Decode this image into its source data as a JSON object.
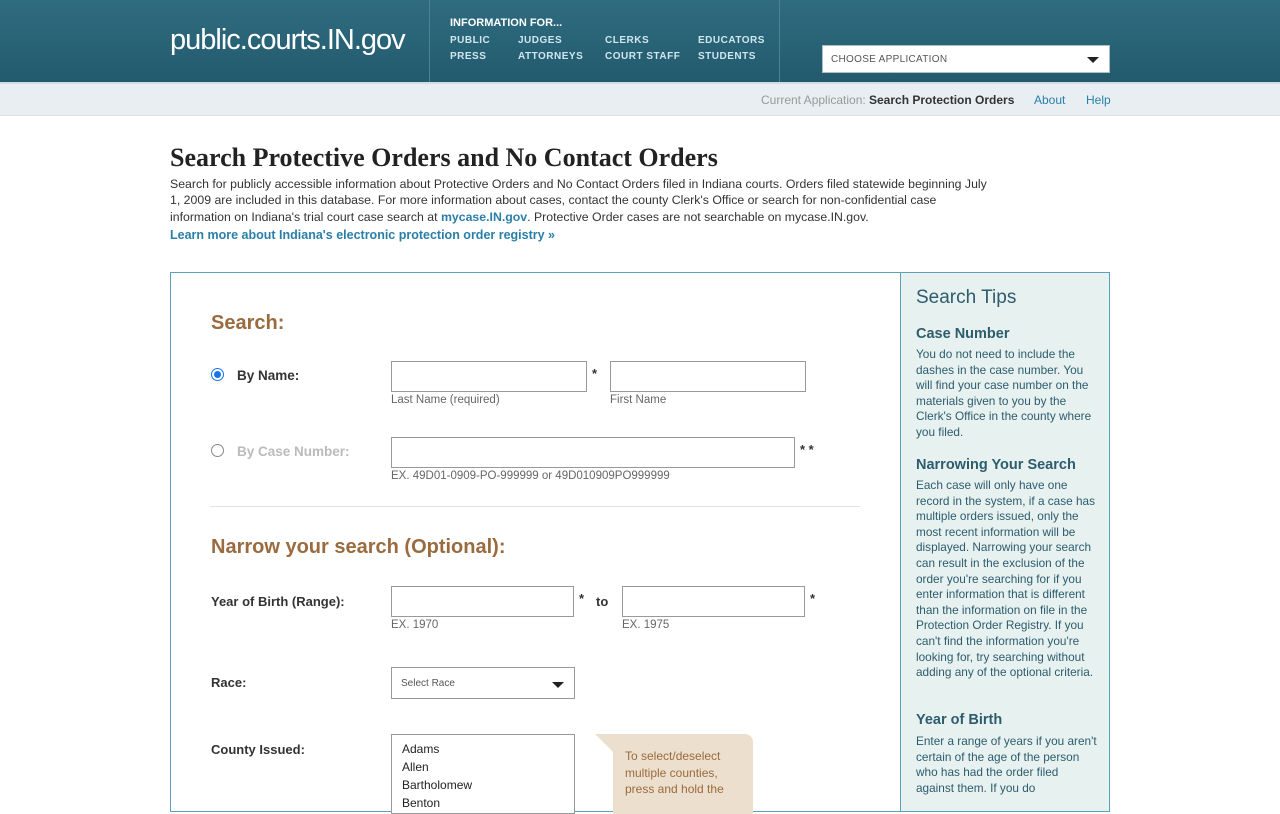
{
  "header": {
    "logo": "public.courts.IN.gov",
    "info_title": "INFORMATION FOR...",
    "links": [
      "PUBLIC",
      "JUDGES",
      "CLERKS",
      "EDUCATORS",
      "PRESS",
      "ATTORNEYS",
      "COURT STAFF",
      "STUDENTS"
    ],
    "app_select": "CHOOSE APPLICATION"
  },
  "subbar": {
    "current_label": "Current Application:",
    "current_value": "Search Protection Orders",
    "about": "About",
    "help": "Help"
  },
  "intro": {
    "title": "Search Protective Orders and No Contact Orders",
    "text_before": "Search for publicly accessible information about Protective Orders and No Contact Orders filed in Indiana courts. Orders filed statewide beginning July 1, 2009 are included in this database. For more information about cases, contact the county Clerk's Office or search for non-confidential case information on Indiana's trial court case search at ",
    "mycase_link": "mycase.IN.gov",
    "text_after": ". Protective Order cases are not searchable on mycase.IN.gov.",
    "learn_more": "Learn more about Indiana's electronic protection order registry »"
  },
  "form": {
    "search_heading": "Search:",
    "by_name_label": "By Name:",
    "last_name_hint": "Last Name (required)",
    "first_name_hint": "First Name",
    "star_single": "*",
    "star_double": "* *",
    "by_case_label": "By Case Number:",
    "case_hint": "EX. 49D01-0909-PO-999999 or 49D010909PO999999",
    "narrow_heading": "Narrow your search (Optional):",
    "yob_label": "Year of Birth (Range):",
    "yob_to": "to",
    "yob_from_hint": "EX. 1970",
    "yob_to_hint": "EX. 1975",
    "race_label": "Race:",
    "race_select": "Select Race",
    "county_label": "County Issued:",
    "counties": [
      "Adams",
      "Allen",
      "Bartholomew",
      "Benton"
    ],
    "callout": "To select/deselect multiple counties, press and hold the"
  },
  "tips": {
    "title": "Search Tips",
    "case_number_head": "Case Number",
    "case_number_body": "You do not need to include the dashes in the case number. You will find your case number on the materials given to you by the Clerk's Office in the county where you filed.",
    "narrow_head": "Narrowing Your Search",
    "narrow_body": "Each case will only have one record in the system, if a case has multiple orders issued, only the most recent information will be displayed. Narrowing your search can result in the exclusion of the order you're searching for if you enter information that is different than the information on file in the Protection Order Registry. If you can't find the information you're looking for, try searching without adding any of the optional criteria.",
    "yob_head": "Year of Birth",
    "yob_body": "Enter a range of years if you aren't certain of the age of the person who has had the order filed against them. If you do"
  },
  "colors": {
    "header_bg": "#2f6c80",
    "accent_link": "#2a7fa8",
    "heading_brown": "#9a6b3e",
    "tips_bg": "#e7f1f0"
  }
}
